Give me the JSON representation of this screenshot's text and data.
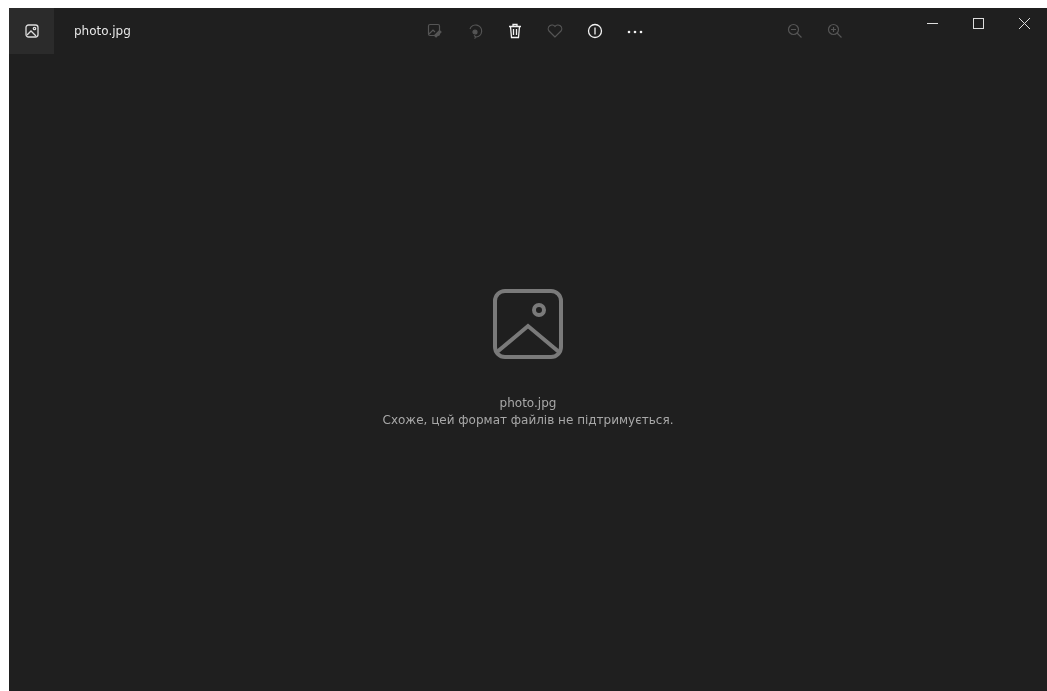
{
  "window": {
    "title": "photo.jpg"
  },
  "toolbar": [
    {
      "kind": "edit",
      "disabled": true
    },
    {
      "kind": "rotate",
      "disabled": true
    },
    {
      "kind": "delete",
      "disabled": false
    },
    {
      "kind": "favorite",
      "disabled": true
    },
    {
      "kind": "info",
      "disabled": false
    },
    {
      "kind": "more",
      "disabled": false
    }
  ],
  "zoom": [
    {
      "kind": "zoom-out",
      "disabled": true
    },
    {
      "kind": "zoom-in",
      "disabled": true
    }
  ],
  "message": {
    "file_name": "photo.jpg",
    "text": "Схоже, цей формат файлів не підтримується."
  }
}
